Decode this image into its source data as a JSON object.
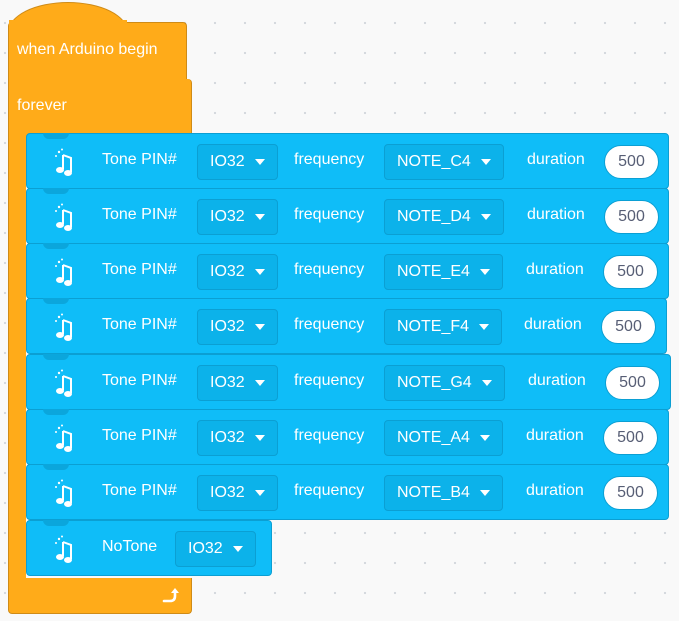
{
  "hat": {
    "label": "when Arduino begin"
  },
  "forever": {
    "label": "forever"
  },
  "colors": {
    "events": "#ffab19",
    "sound": "#0fbdf8"
  },
  "tone_blocks": [
    {
      "label": "Tone PIN#",
      "pin": "IO32",
      "freq_label": "frequency",
      "note": "NOTE_C4",
      "dur_label": "duration",
      "duration": "500"
    },
    {
      "label": "Tone PIN#",
      "pin": "IO32",
      "freq_label": "frequency",
      "note": "NOTE_D4",
      "dur_label": "duration",
      "duration": "500"
    },
    {
      "label": "Tone PIN#",
      "pin": "IO32",
      "freq_label": "frequency",
      "note": "NOTE_E4",
      "dur_label": "duration",
      "duration": "500"
    },
    {
      "label": "Tone PIN#",
      "pin": "IO32",
      "freq_label": "frequency",
      "note": "NOTE_F4",
      "dur_label": "duration",
      "duration": "500"
    },
    {
      "label": "Tone PIN#",
      "pin": "IO32",
      "freq_label": "frequency",
      "note": "NOTE_G4",
      "dur_label": "duration",
      "duration": "500"
    },
    {
      "label": "Tone PIN#",
      "pin": "IO32",
      "freq_label": "frequency",
      "note": "NOTE_A4",
      "dur_label": "duration",
      "duration": "500"
    },
    {
      "label": "Tone PIN#",
      "pin": "IO32",
      "freq_label": "frequency",
      "note": "NOTE_B4",
      "dur_label": "duration",
      "duration": "500"
    }
  ],
  "notone_block": {
    "label": "NoTone",
    "pin": "IO32"
  },
  "icons": {
    "block": "music-note-icon",
    "loop": "loop-arrow-icon",
    "dropdown": "caret-down-icon"
  }
}
